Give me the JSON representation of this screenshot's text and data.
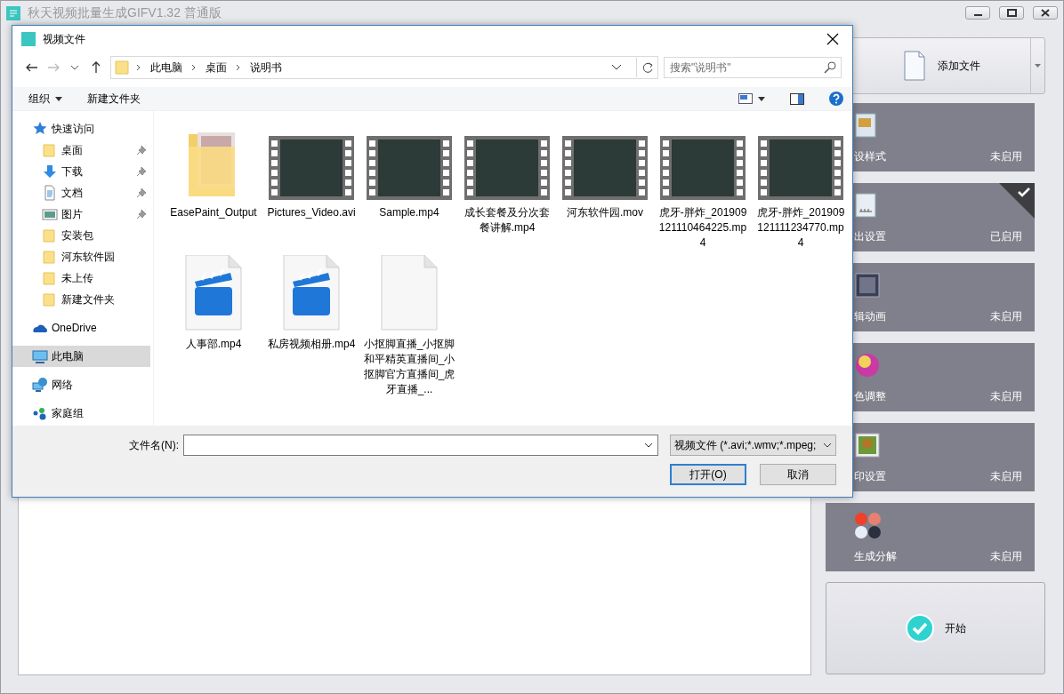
{
  "window": {
    "title": "秋天视频批量生成GIFV1.32 普通版"
  },
  "side_panel": {
    "add_button": {
      "label": "添加文件"
    },
    "cards": [
      {
        "label": "设样式",
        "status": "未启用",
        "enabled": false
      },
      {
        "label": "出设置",
        "status": "已启用",
        "enabled": true
      },
      {
        "label": "辑动画",
        "status": "未启用",
        "enabled": false
      },
      {
        "label": "色调整",
        "status": "未启用",
        "enabled": false
      },
      {
        "label": "印设置",
        "status": "未启用",
        "enabled": false
      },
      {
        "label": "生成分解",
        "status": "未启用",
        "enabled": false
      }
    ],
    "start_button": {
      "label": "开始"
    }
  },
  "dialog": {
    "title": "视频文件",
    "breadcrumb": [
      "此电脑",
      "桌面",
      "说明书"
    ],
    "search": {
      "placeholder": "搜索\"说明书\""
    },
    "toolbar": {
      "organize": "组织",
      "new_folder": "新建文件夹"
    },
    "nav": [
      {
        "label": "快速访问",
        "selected": false,
        "pinned": false,
        "children": [
          {
            "label": "桌面",
            "selected": false,
            "pinned": true
          },
          {
            "label": "下载",
            "selected": false,
            "pinned": true
          },
          {
            "label": "文档",
            "selected": false,
            "pinned": true
          },
          {
            "label": "图片",
            "selected": false,
            "pinned": true
          },
          {
            "label": "安装包",
            "selected": false,
            "pinned": false
          },
          {
            "label": "河东软件园",
            "selected": false,
            "pinned": false
          },
          {
            "label": "未上传",
            "selected": false,
            "pinned": false
          },
          {
            "label": "新建文件夹",
            "selected": false,
            "pinned": false
          }
        ]
      },
      {
        "label": "OneDrive",
        "selected": false,
        "pinned": false
      },
      {
        "label": "此电脑",
        "selected": true,
        "pinned": false
      },
      {
        "label": "网络",
        "selected": false,
        "pinned": false
      },
      {
        "label": "家庭组",
        "selected": false,
        "pinned": false
      }
    ],
    "files": [
      {
        "name": "EasePaint_Output",
        "kind": "folder"
      },
      {
        "name": "Pictures_Video.avi",
        "kind": "video"
      },
      {
        "name": "Sample.mp4",
        "kind": "video"
      },
      {
        "name": "成长套餐及分次套餐讲解.mp4",
        "kind": "video"
      },
      {
        "name": "河东软件园.mov",
        "kind": "video"
      },
      {
        "name": "虎牙-胖炸_201909121110464225.mp4",
        "kind": "video"
      },
      {
        "name": "虎牙-胖炸_201909121111234770.mp4",
        "kind": "video"
      },
      {
        "name": "人事部.mp4",
        "kind": "clip"
      },
      {
        "name": "私房视频相册.mp4",
        "kind": "clip"
      },
      {
        "name": "小抠脚直播_小抠脚和平精英直播间_小抠脚官方直播间_虎牙直播_...",
        "kind": "blank"
      }
    ],
    "file_name": {
      "label": "文件名(N):"
    },
    "file_type": "视频文件 (*.avi;*.wmv;*.mpeg;",
    "buttons": [
      {
        "label": "打开(O)",
        "default": true
      },
      {
        "label": "取消",
        "default": false
      }
    ]
  }
}
